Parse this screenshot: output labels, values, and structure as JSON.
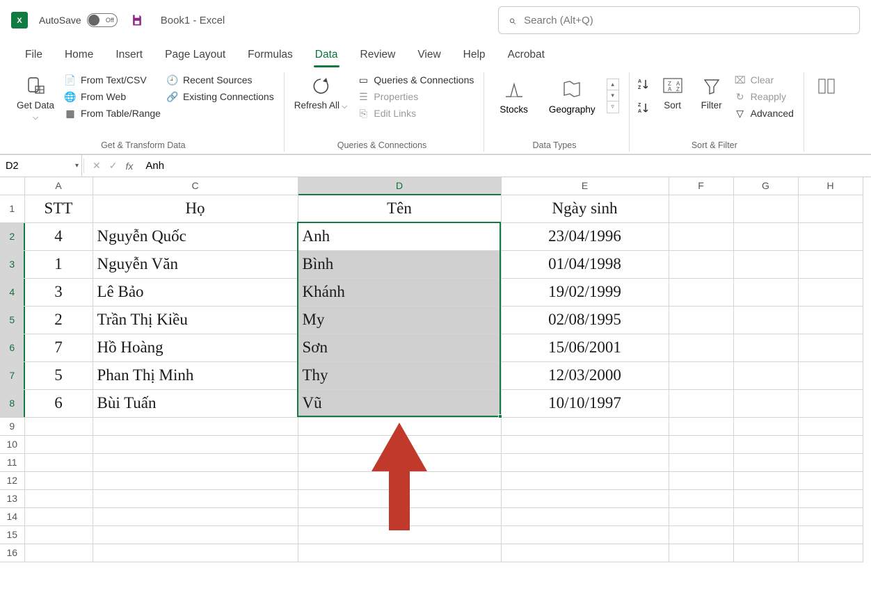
{
  "titlebar": {
    "autosave_label": "AutoSave",
    "toggle_state": "Off",
    "doc_title": "Book1  -  Excel",
    "search_placeholder": "Search (Alt+Q)"
  },
  "tabs": [
    "File",
    "Home",
    "Insert",
    "Page Layout",
    "Formulas",
    "Data",
    "Review",
    "View",
    "Help",
    "Acrobat"
  ],
  "active_tab": "Data",
  "ribbon": {
    "get_data": "Get Data",
    "from_textcsv": "From Text/CSV",
    "from_web": "From Web",
    "from_tablerange": "From Table/Range",
    "recent_sources": "Recent Sources",
    "existing_connections": "Existing Connections",
    "grp_get": "Get & Transform Data",
    "refresh_all": "Refresh All",
    "queries_conn": "Queries & Connections",
    "properties": "Properties",
    "edit_links": "Edit Links",
    "grp_queries": "Queries & Connections",
    "stocks": "Stocks",
    "geography": "Geography",
    "grp_types": "Data Types",
    "sort": "Sort",
    "filter": "Filter",
    "clear": "Clear",
    "reapply": "Reapply",
    "advanced": "Advanced",
    "grp_sortfilter": "Sort & Filter",
    "text_cols": "Te Co"
  },
  "formula_bar": {
    "name_box": "D2",
    "value": "Anh"
  },
  "columns": [
    "A",
    "C",
    "D",
    "E",
    "F",
    "G",
    "H"
  ],
  "col_widths": {
    "A": 98,
    "C": 295,
    "D": 292,
    "E": 241,
    "F": 93,
    "G": 93,
    "H": 93
  },
  "row_heads": [
    1,
    2,
    3,
    4,
    5,
    6,
    7,
    8,
    9,
    10,
    11,
    12,
    13,
    14,
    15,
    16
  ],
  "selected_column": "D",
  "selected_rows": [
    2,
    3,
    4,
    5,
    6,
    7,
    8
  ],
  "active_cell_row": 2,
  "table": {
    "headers": {
      "A": "STT",
      "C": "Họ",
      "D": "Tên",
      "E": "Ngày sinh"
    },
    "rows": [
      {
        "A": "4",
        "C": "Nguyễn Quốc",
        "D": "Anh",
        "E": "23/04/1996"
      },
      {
        "A": "1",
        "C": "Nguyễn Văn",
        "D": "Bình",
        "E": "01/04/1998"
      },
      {
        "A": "3",
        "C": "Lê Bảo",
        "D": "Khánh",
        "E": "19/02/1999"
      },
      {
        "A": "2",
        "C": "Trần Thị Kiều",
        "D": "My",
        "E": "02/08/1995"
      },
      {
        "A": "7",
        "C": "Hồ Hoàng",
        "D": "Sơn",
        "E": "15/06/2001"
      },
      {
        "A": "5",
        "C": "Phan Thị Minh",
        "D": "Thy",
        "E": "12/03/2000"
      },
      {
        "A": "6",
        "C": "Bùi Tuấn",
        "D": "Vũ",
        "E": "10/10/1997"
      }
    ]
  }
}
